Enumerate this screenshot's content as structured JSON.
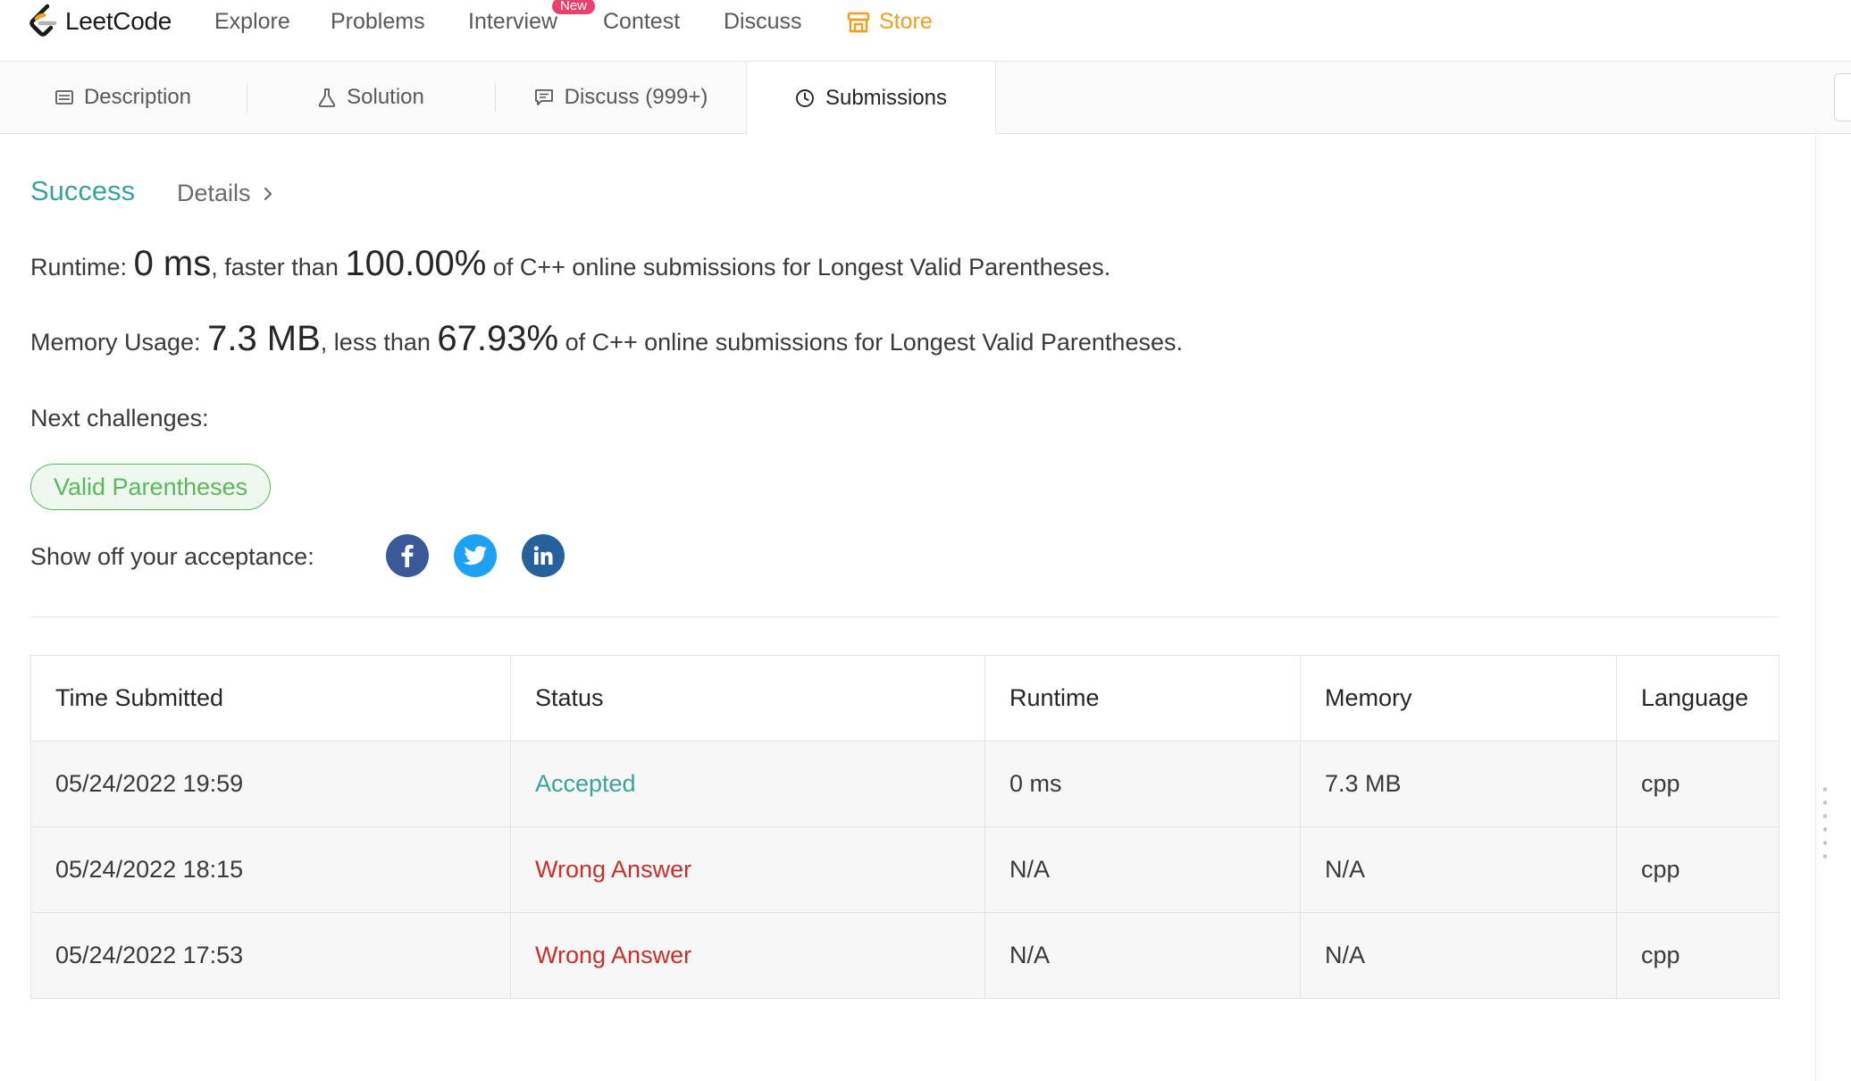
{
  "nav": {
    "logo_text": "LeetCode",
    "items": [
      "Explore",
      "Problems",
      "Interview",
      "Contest",
      "Discuss"
    ],
    "new_badge": "New",
    "store": "Store"
  },
  "tabs": [
    {
      "label": "Description",
      "icon": "description-icon"
    },
    {
      "label": "Solution",
      "icon": "flask-icon"
    },
    {
      "label": "Discuss (999+)",
      "icon": "comment-icon"
    },
    {
      "label": "Submissions",
      "icon": "clock-icon",
      "active": true
    }
  ],
  "result": {
    "status": "Success",
    "details": "Details",
    "runtime": {
      "label": "Runtime:",
      "value": "0 ms",
      "mid": ", faster than",
      "percent": "100.00%",
      "suffix": "of C++ online submissions for Longest Valid Parentheses."
    },
    "memory": {
      "label": "Memory Usage:",
      "value": "7.3 MB",
      "mid": ", less than",
      "percent": "67.93%",
      "suffix": "of C++ online submissions for Longest Valid Parentheses."
    },
    "next_label": "Next challenges:",
    "next_challenge": "Valid Parentheses",
    "share_label": "Show off your acceptance:"
  },
  "submissions": {
    "headers": [
      "Time Submitted",
      "Status",
      "Runtime",
      "Memory",
      "Language"
    ],
    "rows": [
      {
        "time": "05/24/2022 19:59",
        "status": "Accepted",
        "runtime": "0 ms",
        "memory": "7.3 MB",
        "language": "cpp"
      },
      {
        "time": "05/24/2022 18:15",
        "status": "Wrong Answer",
        "runtime": "N/A",
        "memory": "N/A",
        "language": "cpp"
      },
      {
        "time": "05/24/2022 17:53",
        "status": "Wrong Answer",
        "runtime": "N/A",
        "memory": "N/A",
        "language": "cpp"
      }
    ]
  },
  "colors": {
    "success": "#3aa49c",
    "wrong": "#c9302c",
    "store": "#f0a020",
    "badge": "#e8426c",
    "challenge": "#5cb85c"
  }
}
